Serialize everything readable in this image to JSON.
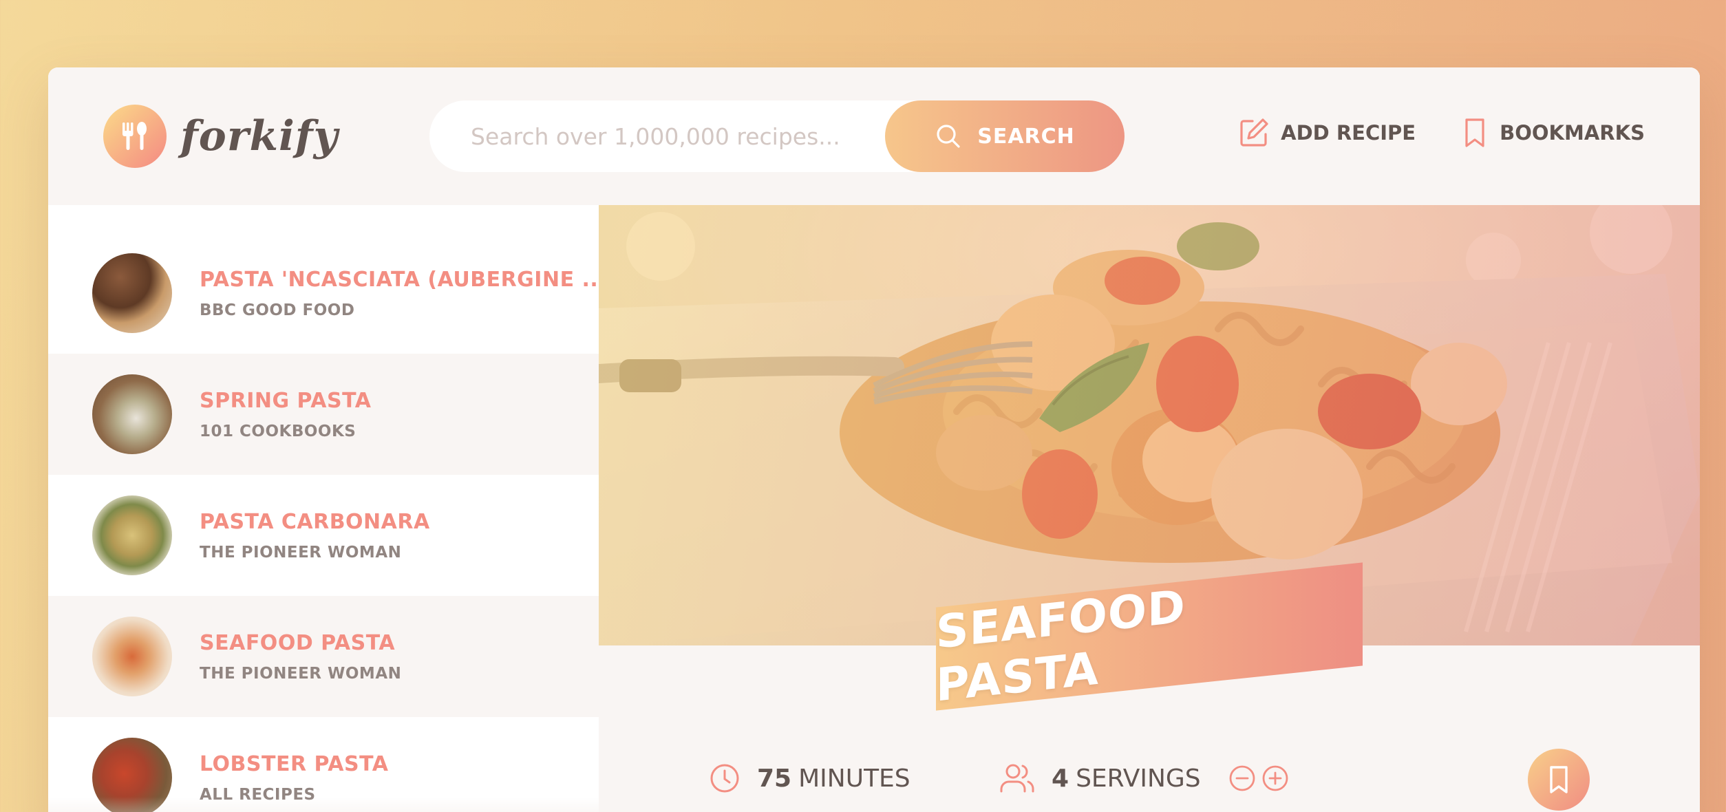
{
  "header": {
    "logo_text": "forkify",
    "search": {
      "placeholder": "Search over 1,000,000 recipes...",
      "button_label": "SEARCH"
    },
    "nav": {
      "add_recipe_label": "ADD RECIPE",
      "bookmarks_label": "BOOKMARKS"
    }
  },
  "results": {
    "items": [
      {
        "title": "PASTA 'NCASCIATA (AUBERGINE ...",
        "publisher": "BBC GOOD FOOD"
      },
      {
        "title": "SPRING PASTA",
        "publisher": "101 COOKBOOKS"
      },
      {
        "title": "PASTA CARBONARA",
        "publisher": "THE PIONEER WOMAN"
      },
      {
        "title": "SEAFOOD PASTA",
        "publisher": "THE PIONEER WOMAN"
      },
      {
        "title": "LOBSTER PASTA",
        "publisher": "ALL RECIPES"
      }
    ]
  },
  "recipe": {
    "title": "SEAFOOD PASTA",
    "cooking_time": "75",
    "cooking_time_unit": "MINUTES",
    "servings": "4",
    "servings_unit": "SERVINGS"
  },
  "colors": {
    "brand_gradient_start": "#fbdb89",
    "brand_gradient_end": "#f48982",
    "primary": "#f38e82",
    "text": "#615551",
    "muted": "#918581",
    "background": "#f9f5f3"
  },
  "icons": {
    "logo": "fork-spoon-icon",
    "search": "search-icon",
    "add_recipe": "edit-icon",
    "bookmarks": "bookmark-icon",
    "time": "clock-icon",
    "servings": "users-icon",
    "decrease": "minus-circle-icon",
    "increase": "plus-circle-icon"
  }
}
